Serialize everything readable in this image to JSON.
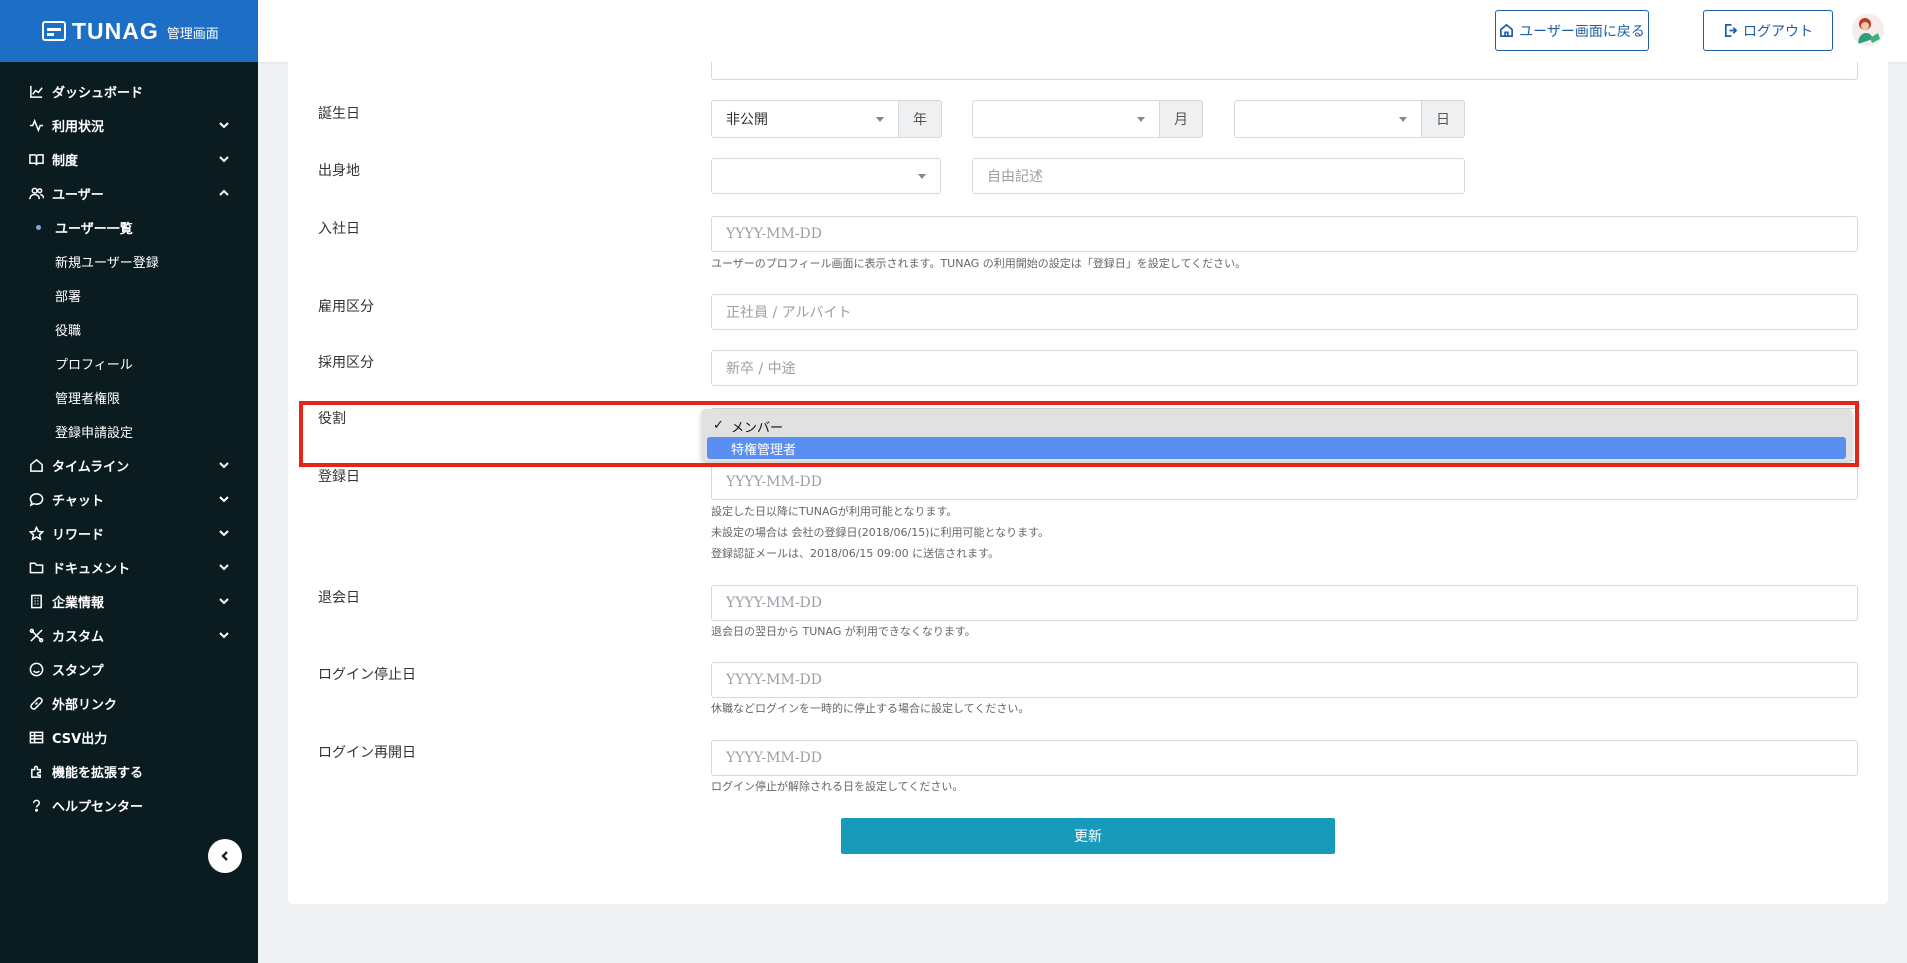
{
  "brand": {
    "name": "TUNAG",
    "subtitle": "管理画面"
  },
  "sidebar": {
    "items": [
      {
        "label": "ダッシュボード",
        "icon": "chart-line-icon",
        "expandable": false
      },
      {
        "label": "利用状況",
        "icon": "activity-icon",
        "expandable": true
      },
      {
        "label": "制度",
        "icon": "book-icon",
        "expandable": true
      },
      {
        "label": "ユーザー",
        "icon": "users-icon",
        "expandable": true,
        "expanded": true,
        "children": [
          {
            "label": "ユーザー一覧",
            "active": true
          },
          {
            "label": "新規ユーザー登録"
          },
          {
            "label": "部署"
          },
          {
            "label": "役職"
          },
          {
            "label": "プロフィール"
          },
          {
            "label": "管理者権限"
          },
          {
            "label": "登録申請設定"
          }
        ]
      },
      {
        "label": "タイムライン",
        "icon": "home-icon",
        "expandable": true
      },
      {
        "label": "チャット",
        "icon": "chat-bubble-icon",
        "expandable": true
      },
      {
        "label": "リワード",
        "icon": "star-icon",
        "expandable": true
      },
      {
        "label": "ドキュメント",
        "icon": "folder-icon",
        "expandable": true
      },
      {
        "label": "企業情報",
        "icon": "building-icon",
        "expandable": true
      },
      {
        "label": "カスタム",
        "icon": "tools-icon",
        "expandable": true
      },
      {
        "label": "スタンプ",
        "icon": "smile-icon",
        "expandable": false
      },
      {
        "label": "外部リンク",
        "icon": "link-icon",
        "expandable": false
      },
      {
        "label": "CSV出力",
        "icon": "table-icon",
        "expandable": false
      },
      {
        "label": "機能を拡張する",
        "icon": "puzzle-icon",
        "expandable": false
      },
      {
        "label": "ヘルプセンター",
        "icon": "help-icon",
        "expandable": false
      }
    ]
  },
  "header": {
    "back_label": "ユーザー画面に戻る",
    "logout_label": "ログアウト"
  },
  "form": {
    "birthday": {
      "label": "誕生日",
      "year_value": "非公開",
      "year_unit": "年",
      "month_unit": "月",
      "day_unit": "日"
    },
    "hometown": {
      "label": "出身地",
      "placeholder": "自由記述"
    },
    "join_date": {
      "label": "入社日",
      "placeholder": "YYYY-MM-DD",
      "help": "ユーザーのプロフィール画面に表示されます。TUNAG の利用開始の設定は「登録日」を設定してください。"
    },
    "employment_type": {
      "label": "雇用区分",
      "placeholder": "正社員 / アルバイト"
    },
    "hiring_type": {
      "label": "採用区分",
      "placeholder": "新卒 / 中途"
    },
    "role": {
      "label": "役割",
      "options": [
        "メンバー",
        "特権管理者"
      ],
      "checked": "メンバー",
      "highlighted": "特権管理者"
    },
    "registration_date": {
      "label": "登録日",
      "placeholder": "YYYY-MM-DD",
      "help": [
        "設定した日以降にTUNAGが利用可能となります。",
        "未設定の場合は 会社の登録日(2018/06/15)に利用可能となります。",
        "登録認証メールは、2018/06/15 09:00 に送信されます。"
      ]
    },
    "withdrawal_date": {
      "label": "退会日",
      "placeholder": "YYYY-MM-DD",
      "help": "退会日の翌日から TUNAG が利用できなくなります。"
    },
    "login_stop_date": {
      "label": "ログイン停止日",
      "placeholder": "YYYY-MM-DD",
      "help": "休職などログインを一時的に停止する場合に設定してください。"
    },
    "login_resume_date": {
      "label": "ログイン再開日",
      "placeholder": "YYYY-MM-DD",
      "help": "ログイン停止が解除される日を設定してください。"
    },
    "submit_label": "更新"
  },
  "colors": {
    "brand_blue": "#1c6fc4",
    "sidebar_bg": "#0b1c21",
    "submit": "#189bbb",
    "highlight_border": "#e4251c",
    "selected_option": "#5a8ef0"
  }
}
